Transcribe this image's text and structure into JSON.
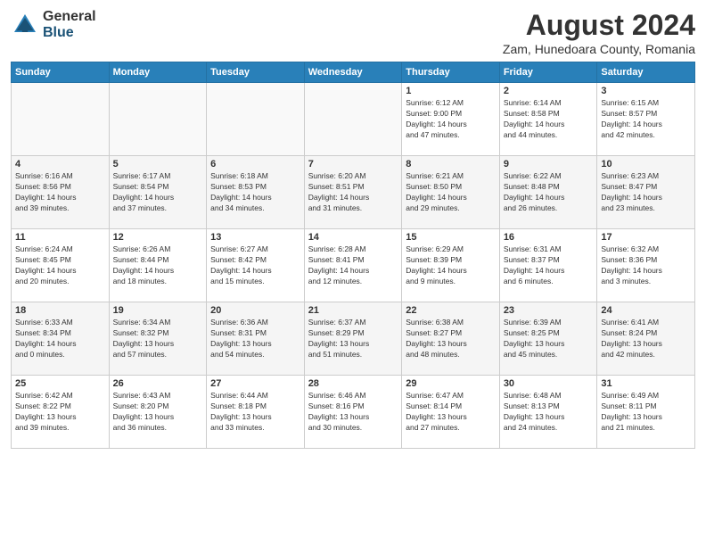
{
  "header": {
    "logo_general": "General",
    "logo_blue": "Blue",
    "title": "August 2024",
    "subtitle": "Zam, Hunedoara County, Romania"
  },
  "days_of_week": [
    "Sunday",
    "Monday",
    "Tuesday",
    "Wednesday",
    "Thursday",
    "Friday",
    "Saturday"
  ],
  "weeks": [
    {
      "days": [
        {
          "num": "",
          "info": ""
        },
        {
          "num": "",
          "info": ""
        },
        {
          "num": "",
          "info": ""
        },
        {
          "num": "",
          "info": ""
        },
        {
          "num": "1",
          "info": "Sunrise: 6:12 AM\nSunset: 9:00 PM\nDaylight: 14 hours\nand 47 minutes."
        },
        {
          "num": "2",
          "info": "Sunrise: 6:14 AM\nSunset: 8:58 PM\nDaylight: 14 hours\nand 44 minutes."
        },
        {
          "num": "3",
          "info": "Sunrise: 6:15 AM\nSunset: 8:57 PM\nDaylight: 14 hours\nand 42 minutes."
        }
      ]
    },
    {
      "days": [
        {
          "num": "4",
          "info": "Sunrise: 6:16 AM\nSunset: 8:56 PM\nDaylight: 14 hours\nand 39 minutes."
        },
        {
          "num": "5",
          "info": "Sunrise: 6:17 AM\nSunset: 8:54 PM\nDaylight: 14 hours\nand 37 minutes."
        },
        {
          "num": "6",
          "info": "Sunrise: 6:18 AM\nSunset: 8:53 PM\nDaylight: 14 hours\nand 34 minutes."
        },
        {
          "num": "7",
          "info": "Sunrise: 6:20 AM\nSunset: 8:51 PM\nDaylight: 14 hours\nand 31 minutes."
        },
        {
          "num": "8",
          "info": "Sunrise: 6:21 AM\nSunset: 8:50 PM\nDaylight: 14 hours\nand 29 minutes."
        },
        {
          "num": "9",
          "info": "Sunrise: 6:22 AM\nSunset: 8:48 PM\nDaylight: 14 hours\nand 26 minutes."
        },
        {
          "num": "10",
          "info": "Sunrise: 6:23 AM\nSunset: 8:47 PM\nDaylight: 14 hours\nand 23 minutes."
        }
      ]
    },
    {
      "days": [
        {
          "num": "11",
          "info": "Sunrise: 6:24 AM\nSunset: 8:45 PM\nDaylight: 14 hours\nand 20 minutes."
        },
        {
          "num": "12",
          "info": "Sunrise: 6:26 AM\nSunset: 8:44 PM\nDaylight: 14 hours\nand 18 minutes."
        },
        {
          "num": "13",
          "info": "Sunrise: 6:27 AM\nSunset: 8:42 PM\nDaylight: 14 hours\nand 15 minutes."
        },
        {
          "num": "14",
          "info": "Sunrise: 6:28 AM\nSunset: 8:41 PM\nDaylight: 14 hours\nand 12 minutes."
        },
        {
          "num": "15",
          "info": "Sunrise: 6:29 AM\nSunset: 8:39 PM\nDaylight: 14 hours\nand 9 minutes."
        },
        {
          "num": "16",
          "info": "Sunrise: 6:31 AM\nSunset: 8:37 PM\nDaylight: 14 hours\nand 6 minutes."
        },
        {
          "num": "17",
          "info": "Sunrise: 6:32 AM\nSunset: 8:36 PM\nDaylight: 14 hours\nand 3 minutes."
        }
      ]
    },
    {
      "days": [
        {
          "num": "18",
          "info": "Sunrise: 6:33 AM\nSunset: 8:34 PM\nDaylight: 14 hours\nand 0 minutes."
        },
        {
          "num": "19",
          "info": "Sunrise: 6:34 AM\nSunset: 8:32 PM\nDaylight: 13 hours\nand 57 minutes."
        },
        {
          "num": "20",
          "info": "Sunrise: 6:36 AM\nSunset: 8:31 PM\nDaylight: 13 hours\nand 54 minutes."
        },
        {
          "num": "21",
          "info": "Sunrise: 6:37 AM\nSunset: 8:29 PM\nDaylight: 13 hours\nand 51 minutes."
        },
        {
          "num": "22",
          "info": "Sunrise: 6:38 AM\nSunset: 8:27 PM\nDaylight: 13 hours\nand 48 minutes."
        },
        {
          "num": "23",
          "info": "Sunrise: 6:39 AM\nSunset: 8:25 PM\nDaylight: 13 hours\nand 45 minutes."
        },
        {
          "num": "24",
          "info": "Sunrise: 6:41 AM\nSunset: 8:24 PM\nDaylight: 13 hours\nand 42 minutes."
        }
      ]
    },
    {
      "days": [
        {
          "num": "25",
          "info": "Sunrise: 6:42 AM\nSunset: 8:22 PM\nDaylight: 13 hours\nand 39 minutes."
        },
        {
          "num": "26",
          "info": "Sunrise: 6:43 AM\nSunset: 8:20 PM\nDaylight: 13 hours\nand 36 minutes."
        },
        {
          "num": "27",
          "info": "Sunrise: 6:44 AM\nSunset: 8:18 PM\nDaylight: 13 hours\nand 33 minutes."
        },
        {
          "num": "28",
          "info": "Sunrise: 6:46 AM\nSunset: 8:16 PM\nDaylight: 13 hours\nand 30 minutes."
        },
        {
          "num": "29",
          "info": "Sunrise: 6:47 AM\nSunset: 8:14 PM\nDaylight: 13 hours\nand 27 minutes."
        },
        {
          "num": "30",
          "info": "Sunrise: 6:48 AM\nSunset: 8:13 PM\nDaylight: 13 hours\nand 24 minutes."
        },
        {
          "num": "31",
          "info": "Sunrise: 6:49 AM\nSunset: 8:11 PM\nDaylight: 13 hours\nand 21 minutes."
        }
      ]
    }
  ]
}
